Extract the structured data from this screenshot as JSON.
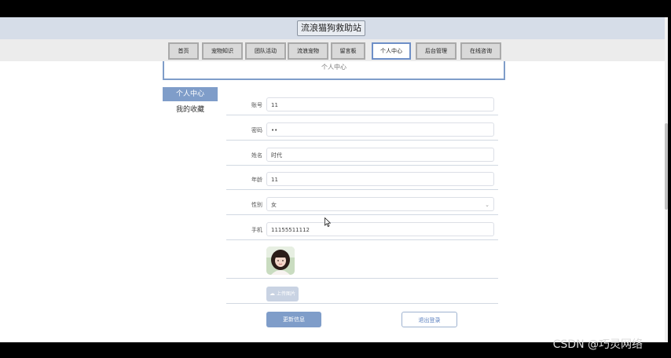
{
  "site": {
    "title": "流浪猫狗救助站"
  },
  "nav": {
    "items": [
      {
        "label": "首页"
      },
      {
        "label": "宠物知识"
      },
      {
        "label": "团队活动"
      },
      {
        "label": "流浪宠物"
      },
      {
        "label": "留言板"
      },
      {
        "label": "个人中心",
        "active": true
      },
      {
        "label": "后台管理"
      },
      {
        "label": "在线咨询"
      }
    ]
  },
  "banner": {
    "text": "个人中心"
  },
  "side_menu": {
    "items": [
      {
        "label": "个人中心",
        "active": true
      },
      {
        "label": "我的收藏"
      }
    ]
  },
  "form": {
    "account": {
      "label": "账号",
      "value": "11"
    },
    "password": {
      "label": "密码",
      "value": "••"
    },
    "name": {
      "label": "姓名",
      "value": "时代"
    },
    "age": {
      "label": "年龄",
      "value": "11"
    },
    "gender": {
      "label": "性别",
      "value": "女"
    },
    "phone": {
      "label": "手机",
      "value": "11155511112"
    },
    "upload_label": "上传图片",
    "update_label": "更新信息",
    "logout_label": "退出登录"
  },
  "watermark": {
    "text": "CSDN @巧灵网络"
  },
  "colors": {
    "accent": "#7f9dc9",
    "header_bg": "#d6dde8"
  }
}
